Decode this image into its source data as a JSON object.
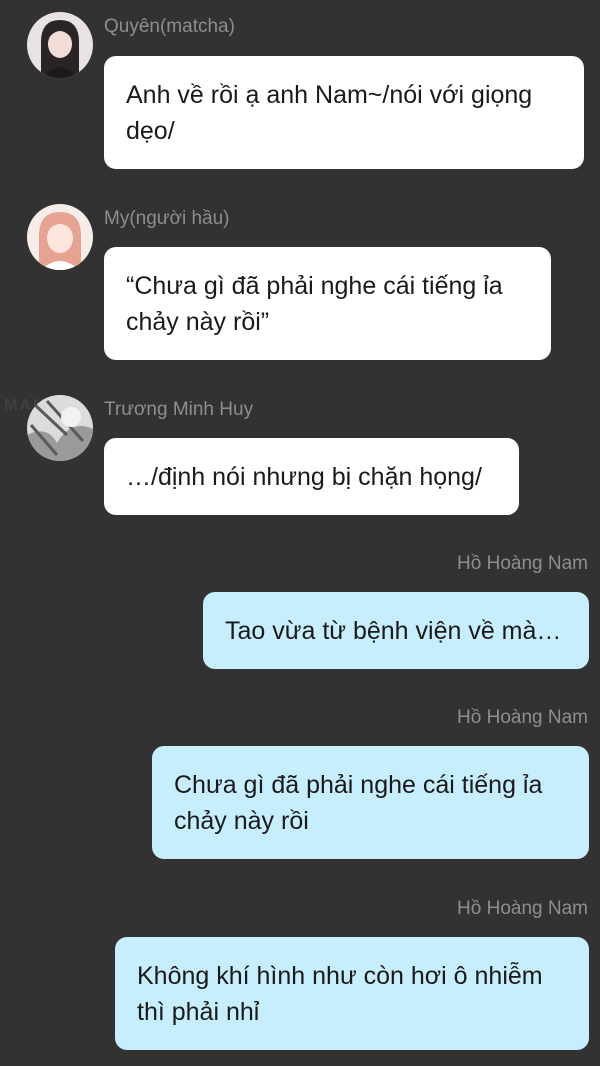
{
  "watermark": "MANGA",
  "messages": [
    {
      "sender": "Quyên(matcha)",
      "side": "left",
      "text": "Anh về rồi ạ anh Nam~/nói với giọng dẹo/"
    },
    {
      "sender": "My(người hầu)",
      "side": "left",
      "text": "“Chưa gì đã phải nghe cái tiếng ỉa chảy này rồi”"
    },
    {
      "sender": "Trương Minh Huy",
      "side": "left",
      "text": "…/định nói nhưng bị chặn họng/"
    },
    {
      "sender": "Hồ Hoàng Nam",
      "side": "right",
      "text": "Tao vừa từ bệnh viện về mà…"
    },
    {
      "sender": "Hồ Hoàng Nam",
      "side": "right",
      "text": "Chưa gì đã phải nghe cái tiếng ỉa chảy này rồi"
    },
    {
      "sender": "Hồ Hoàng Nam",
      "side": "right",
      "text": "Không khí hình như còn hơi ô nhiễm thì phải nhỉ"
    }
  ],
  "colors": {
    "background": "#323232",
    "bubble_incoming": "#ffffff",
    "bubble_outgoing": "#c6eefc",
    "sender_name": "#8e8e8e"
  },
  "icons": [
    "avatar-quyen",
    "avatar-my",
    "avatar-huy"
  ]
}
